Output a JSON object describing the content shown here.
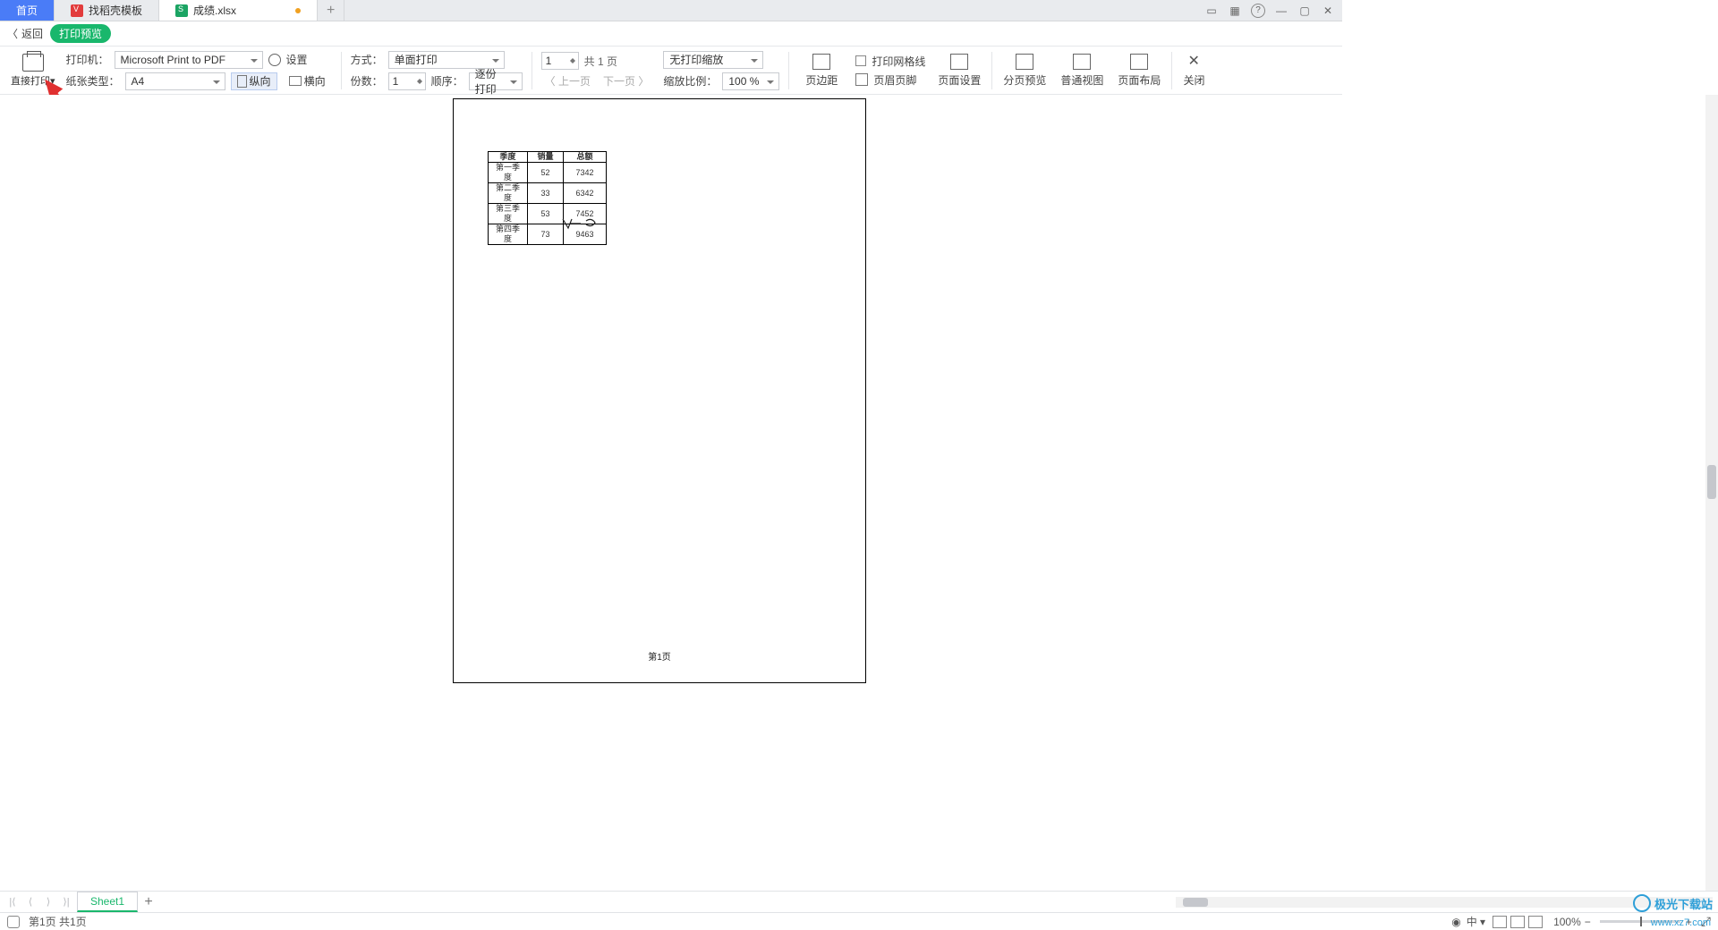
{
  "tabs": {
    "home": "首页",
    "template": "找稻壳模板",
    "file": "成绩.xlsx"
  },
  "row2": {
    "back": "返回",
    "preview_pill": "打印预览"
  },
  "toolbar": {
    "direct_print": "直接打印",
    "printer_label": "打印机：",
    "printer_value": "Microsoft Print to PDF",
    "settings": "设置",
    "paper_label": "纸张类型：",
    "paper_value": "A4",
    "portrait": "纵向",
    "landscape": "横向",
    "mode_label": "方式：",
    "mode_value": "单面打印",
    "copies_label": "份数：",
    "copies_value": "1",
    "order_label": "顺序：",
    "order_value": "逐份打印",
    "page_spin_value": "1",
    "page_total": "共 1 页",
    "prev_page": "上一页",
    "next_page": "下一页",
    "scale_select": "无打印缩放",
    "zoom_ratio_label": "缩放比例：",
    "zoom_ratio_value": "100 %",
    "margins": "页边距",
    "grid_check": "打印网格线",
    "header_footer": "页眉页脚",
    "page_setup": "页面设置",
    "paginate_preview": "分页预览",
    "normal_view": "普通视图",
    "page_layout": "页面布局",
    "close": "关闭"
  },
  "paper": {
    "footer": "第1页",
    "table": {
      "headers": [
        "季度",
        "销量",
        "总额"
      ],
      "rows": [
        [
          "第一季度",
          "52",
          "7342"
        ],
        [
          "第二季度",
          "33",
          "6342"
        ],
        [
          "第三季度",
          "53",
          "7452"
        ],
        [
          "第四季度",
          "73",
          "9463"
        ]
      ]
    }
  },
  "sheetrow": {
    "sheet1": "Sheet1"
  },
  "status": {
    "page_info": "第1页 共1页",
    "lang": "中",
    "zoom": "100%"
  },
  "watermark": {
    "name": "极光下载站",
    "url": "www.xz7.com"
  }
}
